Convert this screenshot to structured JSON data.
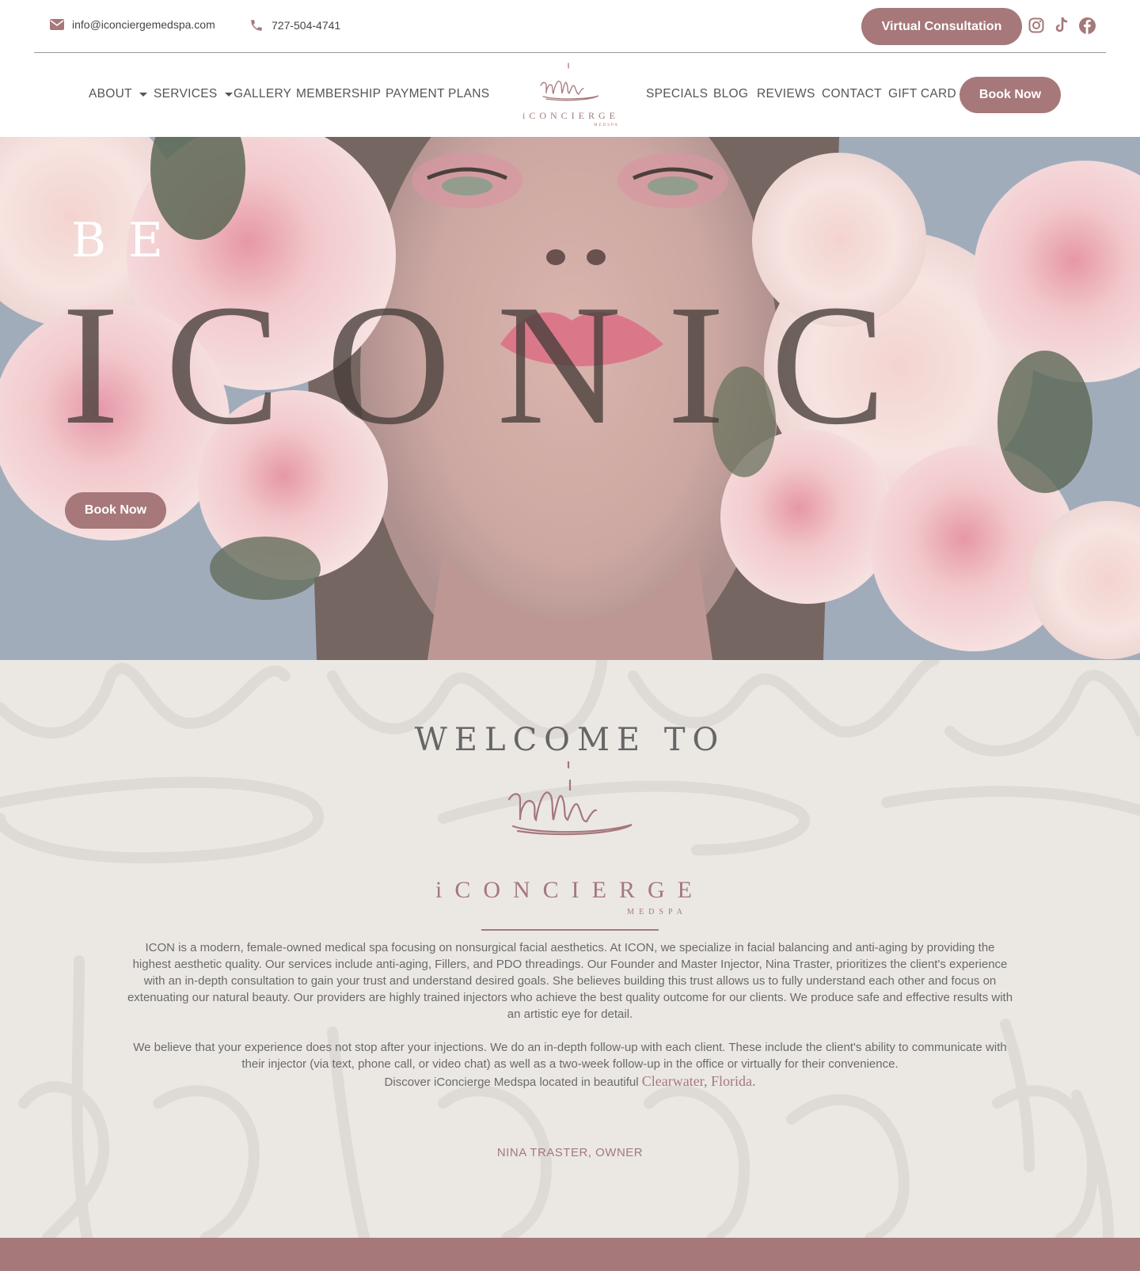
{
  "topbar": {
    "email": "info@iconciergemedspa.com",
    "phone": "727-504-4741",
    "virtual_consultation": "Virtual Consultation",
    "social": [
      "instagram-icon",
      "tiktok-icon",
      "facebook-icon"
    ]
  },
  "nav": {
    "left": [
      "ABOUT",
      "SERVICES",
      "GALLERY",
      "MEMBERSHIP",
      "PAYMENT PLANS"
    ],
    "right": [
      "SPECIALS",
      "BLOG",
      "REVIEWS",
      "CONTACT",
      "GIFT CARD"
    ],
    "book_now": "Book Now",
    "logo_text": "iCONCIERGE",
    "logo_sub": "MEDSPA"
  },
  "hero": {
    "kicker": "BE",
    "headline": "ICONIC",
    "book_now": "Book Now"
  },
  "welcome": {
    "title": "WELCOME TO",
    "logo_text": "iCONCIERGE",
    "logo_sub": "MEDSPA",
    "paragraph1": "ICON is a modern, female-owned medical spa focusing on nonsurgical facial aesthetics. At ICON, we specialize in facial balancing and anti-aging by providing the highest aesthetic quality. Our services include anti-aging, Fillers, and PDO threadings. Our Founder and Master Injector, Nina Traster, prioritizes the client's experience with an in-depth consultation to gain your trust and understand desired goals. She believes building this trust allows us to fully understand each other and focus on extenuating our natural beauty. Our providers are highly trained injectors who achieve the best quality outcome for our clients. We produce safe and effective results with an artistic eye for detail.",
    "paragraph2": "We believe that your experience does not stop after your injections. We do an in-depth follow-up with each client. These include the client's ability to communicate with their injector (via text, phone call, or video chat) as well as a two-week follow-up in the office or virtually for their convenience.",
    "discover_prefix": "Discover iConcierge Medspa located in beautiful",
    "discover_location": "Clearwater, Florida.",
    "owner": "NINA TRASTER, OWNER"
  },
  "colors": {
    "brand": "#a6787a",
    "welcome_bg": "#ebe8e4",
    "text": "#555555"
  }
}
